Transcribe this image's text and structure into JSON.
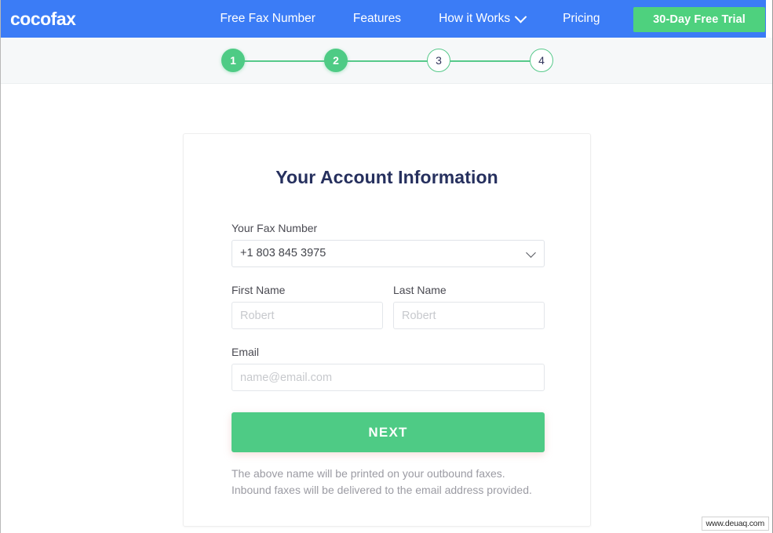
{
  "navbar": {
    "logo": "cocofax",
    "links": [
      {
        "label": "Free Fax Number",
        "has_dropdown": false
      },
      {
        "label": "Features",
        "has_dropdown": false
      },
      {
        "label": "How it Works",
        "has_dropdown": true
      },
      {
        "label": "Pricing",
        "has_dropdown": false
      }
    ],
    "cta_label": "30-Day Free Trial",
    "bg_color": "#3b7cf6",
    "cta_color": "#4ed17e"
  },
  "stepper": {
    "steps": [
      {
        "number": "1",
        "state": "done"
      },
      {
        "number": "2",
        "state": "done"
      },
      {
        "number": "3",
        "state": "todo"
      },
      {
        "number": "4",
        "state": "todo"
      }
    ],
    "accent_color": "#4ecb85"
  },
  "card": {
    "title": "Your Account Information",
    "fax_number": {
      "label": "Your Fax Number",
      "value": "+1 803 845 3975",
      "options": [
        "+1 803 845 3975"
      ]
    },
    "first_name": {
      "label": "First Name",
      "value": "",
      "placeholder": "Robert"
    },
    "last_name": {
      "label": "Last Name",
      "value": "",
      "placeholder": "Robert"
    },
    "email": {
      "label": "Email",
      "value": "",
      "placeholder": "name@email.com"
    },
    "submit_label": "NEXT",
    "helper_line1": "The above name will be printed on your outbound faxes.",
    "helper_line2": "Inbound faxes will be delivered to the email address provided."
  },
  "watermark": "www.deuaq.com"
}
